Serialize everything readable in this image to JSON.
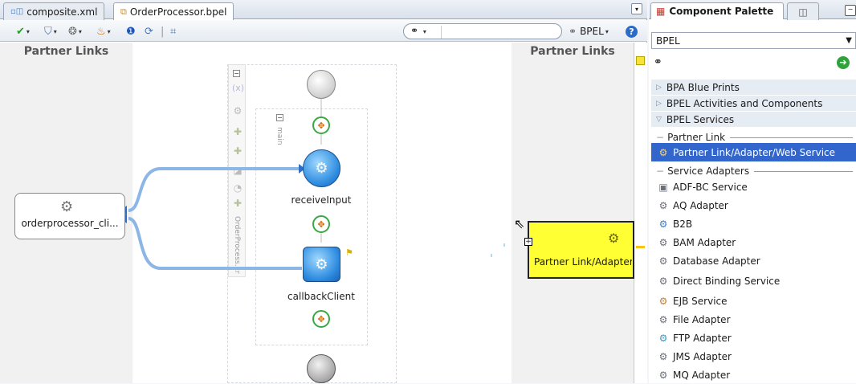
{
  "editor": {
    "tabs": [
      {
        "label": "composite.xml",
        "icon": "composite-file-icon"
      },
      {
        "label": "OrderProcessor.bpel",
        "icon": "bpel-process-icon",
        "active": true
      }
    ],
    "toolbar": {
      "search_placeholder": "",
      "bpel_menu_label": "BPEL",
      "search_dropdown_icon": "binoculars-icon"
    }
  },
  "canvas": {
    "left_lane_title": "Partner Links",
    "right_lane_title": "Partner Links",
    "scope_name": "main",
    "process_name": "OrderProcess.xr",
    "activities": [
      {
        "name": "receiveInput",
        "type": "receive"
      },
      {
        "name": "callbackClient",
        "type": "invoke"
      }
    ],
    "partner_client_label": "orderprocessor_cli...",
    "drop_node_label": "Partner Link/Adapter/Web Service",
    "variable_symbol": "(x)"
  },
  "palette": {
    "title": "Component Palette",
    "category": "BPEL",
    "sections": [
      {
        "label": "BPA Blue Prints",
        "expanded": false
      },
      {
        "label": "BPEL Activities and Components",
        "expanded": false
      },
      {
        "label": "BPEL Services",
        "expanded": true
      }
    ],
    "groups": [
      {
        "label": "Partner Link"
      },
      {
        "label": "Service Adapters"
      }
    ],
    "partner_link_items": [
      {
        "label": "Partner Link/Adapter/Web Service",
        "selected": true
      }
    ],
    "adapter_items": [
      {
        "label": "ADF-BC Service"
      },
      {
        "label": "AQ Adapter"
      },
      {
        "label": "B2B"
      },
      {
        "label": "BAM Adapter"
      },
      {
        "label": "Database Adapter"
      },
      {
        "label": "Direct Binding Service"
      },
      {
        "label": "EJB Service"
      },
      {
        "label": "File Adapter"
      },
      {
        "label": "FTP Adapter"
      },
      {
        "label": "JMS Adapter"
      },
      {
        "label": "MQ Adapter"
      }
    ]
  },
  "colors": {
    "selection": "#3366cc",
    "drop_node": "#ffff33",
    "activity_blue": "#2f8ce0",
    "connector_green": "#3aa845"
  }
}
